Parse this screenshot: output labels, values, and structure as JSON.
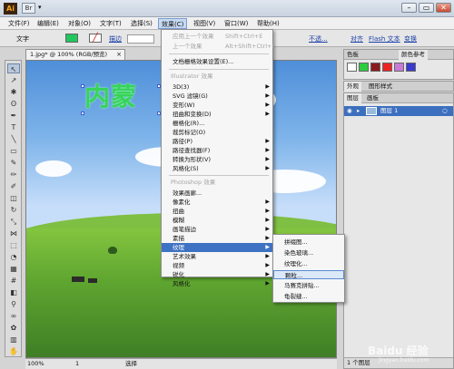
{
  "app": {
    "logo": "Ai",
    "bridge_label": "Br"
  },
  "window_controls": {
    "minimize": "–",
    "restore": "▭",
    "close": "✕"
  },
  "menubar": {
    "items": [
      "文件(F)",
      "编辑(E)",
      "对象(O)",
      "文字(T)",
      "选择(S)",
      "效果(C)",
      "视图(V)",
      "窗口(W)",
      "帮助(H)"
    ]
  },
  "controlbar": {
    "tool_label": "文字",
    "stroke_label": "描边",
    "opacity_label": "不透...",
    "align_label": "对齐",
    "flash_text_label": "Flash 文本",
    "transform_label": "变换",
    "fill_color": "#22c55e"
  },
  "document": {
    "tab_title": "1.jpg* @ 100% (RGB/预览)",
    "art_text": "内蒙",
    "zoom": "100%",
    "page": "1",
    "status": "选择"
  },
  "effects_menu": {
    "top_items": [
      {
        "label": "应用上一个效果",
        "shortcut": "Shift+Ctrl+E"
      },
      {
        "label": "上一个效果",
        "shortcut": "Alt+Shift+Ctrl+E"
      }
    ],
    "settings_item": "文档栅格效果设置(E)...",
    "section_illustrator": "Illustrator 效果",
    "illustrator_items": [
      "3D(3)",
      "SVG 滤镜(G)",
      "变形(W)",
      "扭曲和变换(D)",
      "栅格化(R)...",
      "裁剪标记(O)",
      "路径(P)",
      "路径查找器(F)",
      "转换为形状(V)",
      "风格化(S)"
    ],
    "section_photoshop": "Photoshop 效果",
    "photoshop_items": [
      "效果画廊...",
      "像素化",
      "扭曲",
      "模糊",
      "画笔描边",
      "素描",
      "纹理",
      "艺术效果",
      "视频",
      "锐化",
      "风格化"
    ],
    "active_item": "纹理"
  },
  "texture_submenu": {
    "items": [
      "拼缀图...",
      "染色玻璃...",
      "纹理化...",
      "颗粒...",
      "马赛克拼贴...",
      "龟裂缝..."
    ],
    "active_item": "颗粒..."
  },
  "panels": {
    "appearance_tabs": [
      "外观",
      "图形样式"
    ],
    "swatch_tabs": [
      "色板",
      "颜色参考"
    ],
    "layers_tabs": [
      "图层",
      "画板"
    ],
    "layer_name": "图层 1",
    "layers_count": "1 个图层"
  },
  "watermark": {
    "main": "Baidu 经验",
    "sub": "jingyan.baidu.com"
  }
}
